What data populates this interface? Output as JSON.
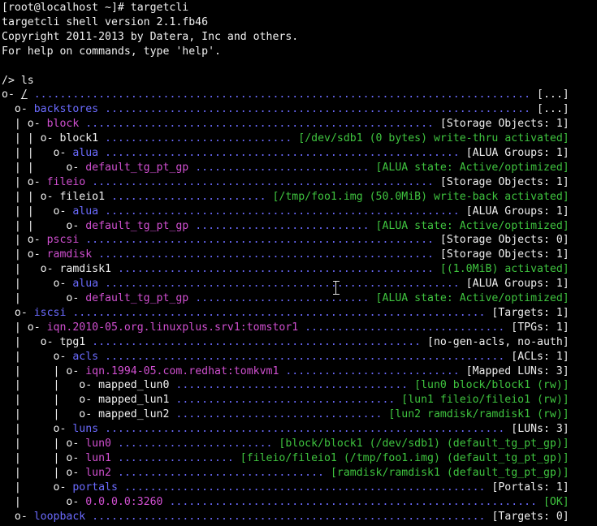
{
  "header": [
    "[root@localhost ~]# targetcli",
    "targetcli shell version 2.1.fb46",
    "Copyright 2011-2013 by Datera, Inc and others.",
    "For help on commands, type 'help'."
  ],
  "prompt": "/> ls",
  "tree": [
    {
      "prefix": "o- ",
      "name": "/",
      "name_color": "white",
      "info": "[...]",
      "info_color": "white"
    },
    {
      "prefix": "  o- ",
      "name": "backstores",
      "name_color": "blue",
      "info": "[...]",
      "info_color": "white"
    },
    {
      "prefix": "  | o- ",
      "name": "block",
      "name_color": "mag",
      "info": "[Storage Objects: 1]",
      "info_color": "white"
    },
    {
      "prefix": "  | | o- ",
      "name": "block1",
      "name_color": "white",
      "info": "[/dev/sdb1 (0 bytes) write-thru activated]",
      "info_color": "green"
    },
    {
      "prefix": "  | |   o- ",
      "name": "alua",
      "name_color": "blue",
      "info": "[ALUA Groups: 1]",
      "info_color": "white"
    },
    {
      "prefix": "  | |     o- ",
      "name": "default_tg_pt_gp",
      "name_color": "mag",
      "info": "[ALUA state: Active/optimized]",
      "info_color": "green"
    },
    {
      "prefix": "  | o- ",
      "name": "fileio",
      "name_color": "mag",
      "info": "[Storage Objects: 1]",
      "info_color": "white"
    },
    {
      "prefix": "  | | o- ",
      "name": "fileio1",
      "name_color": "white",
      "info": "[/tmp/foo1.img (50.0MiB) write-back activated]",
      "info_color": "green"
    },
    {
      "prefix": "  | |   o- ",
      "name": "alua",
      "name_color": "blue",
      "info": "[ALUA Groups: 1]",
      "info_color": "white"
    },
    {
      "prefix": "  | |     o- ",
      "name": "default_tg_pt_gp",
      "name_color": "mag",
      "info": "[ALUA state: Active/optimized]",
      "info_color": "green"
    },
    {
      "prefix": "  | o- ",
      "name": "pscsi",
      "name_color": "mag",
      "info": "[Storage Objects: 0]",
      "info_color": "white"
    },
    {
      "prefix": "  | o- ",
      "name": "ramdisk",
      "name_color": "mag",
      "info": "[Storage Objects: 1]",
      "info_color": "white"
    },
    {
      "prefix": "  |   o- ",
      "name": "ramdisk1",
      "name_color": "white",
      "info": "[(1.0MiB) activated]",
      "info_color": "green"
    },
    {
      "prefix": "  |     o- ",
      "name": "alua",
      "name_color": "blue",
      "info": "[ALUA Groups: 1]",
      "info_color": "white"
    },
    {
      "prefix": "  |       o- ",
      "name": "default_tg_pt_gp",
      "name_color": "mag",
      "info": "[ALUA state: Active/optimized]",
      "info_color": "green"
    },
    {
      "prefix": "  o- ",
      "name": "iscsi",
      "name_color": "blue",
      "info": "[Targets: 1]",
      "info_color": "white"
    },
    {
      "prefix": "  | o- ",
      "name": "iqn.2010-05.org.linuxplus.srv1:tomstor1",
      "name_color": "mag",
      "info": "[TPGs: 1]",
      "info_color": "white"
    },
    {
      "prefix": "  |   o- ",
      "name": "tpg1",
      "name_color": "white",
      "info": "[no-gen-acls, no-auth]",
      "info_color": "white"
    },
    {
      "prefix": "  |     o- ",
      "name": "acls",
      "name_color": "blue",
      "info": "[ACLs: 1]",
      "info_color": "white"
    },
    {
      "prefix": "  |     | o- ",
      "name": "iqn.1994-05.com.redhat:tomkvm1",
      "name_color": "mag",
      "info": "[Mapped LUNs: 3]",
      "info_color": "white"
    },
    {
      "prefix": "  |     |   o- ",
      "name": "mapped_lun0",
      "name_color": "white",
      "info": "[lun0 block/block1 (rw)]",
      "info_color": "green"
    },
    {
      "prefix": "  |     |   o- ",
      "name": "mapped_lun1",
      "name_color": "white",
      "info": "[lun1 fileio/fileio1 (rw)]",
      "info_color": "green"
    },
    {
      "prefix": "  |     |   o- ",
      "name": "mapped_lun2",
      "name_color": "white",
      "info": "[lun2 ramdisk/ramdisk1 (rw)]",
      "info_color": "green"
    },
    {
      "prefix": "  |     o- ",
      "name": "luns",
      "name_color": "blue",
      "info": "[LUNs: 3]",
      "info_color": "white"
    },
    {
      "prefix": "  |     | o- ",
      "name": "lun0",
      "name_color": "mag",
      "info": "[block/block1 (/dev/sdb1) (default_tg_pt_gp)]",
      "info_color": "green"
    },
    {
      "prefix": "  |     | o- ",
      "name": "lun1",
      "name_color": "mag",
      "info": "[fileio/fileio1 (/tmp/foo1.img) (default_tg_pt_gp)]",
      "info_color": "green"
    },
    {
      "prefix": "  |     | o- ",
      "name": "lun2",
      "name_color": "mag",
      "info": "[ramdisk/ramdisk1 (default_tg_pt_gp)]",
      "info_color": "green"
    },
    {
      "prefix": "  |     o- ",
      "name": "portals",
      "name_color": "blue",
      "info": "[Portals: 1]",
      "info_color": "white"
    },
    {
      "prefix": "  |       o- ",
      "name": "0.0.0.0:3260",
      "name_color": "mag",
      "info": "[OK]",
      "info_color": "green"
    },
    {
      "prefix": "  o- ",
      "name": "loopback",
      "name_color": "blue",
      "info": "[Targets: 0]",
      "info_color": "white"
    }
  ],
  "colors": {
    "background": "#000000",
    "text": "#f0f0f0",
    "node_blue": "#6b6bff",
    "node_magenta": "#d04fd0",
    "status_green": "#3fc43f"
  },
  "mouse_cursor_icon": "i-beam-cursor-icon"
}
